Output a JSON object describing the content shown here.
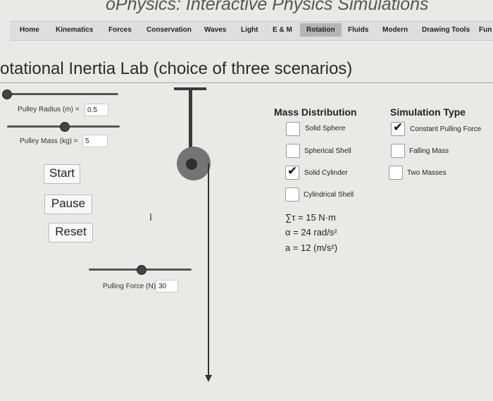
{
  "site": {
    "title": "oPhysics: Interactive Physics Simulations"
  },
  "nav": {
    "items": [
      {
        "label": "Home"
      },
      {
        "label": "Kinematics"
      },
      {
        "label": "Forces"
      },
      {
        "label": "Conservation"
      },
      {
        "label": "Waves"
      },
      {
        "label": "Light"
      },
      {
        "label": "E & M"
      },
      {
        "label": "Rotation",
        "active": true
      },
      {
        "label": "Fluids"
      },
      {
        "label": "Modern"
      },
      {
        "label": "Drawing Tools"
      },
      {
        "label": "Fun"
      }
    ]
  },
  "page": {
    "title": "otational Inertia Lab (choice of three scenarios)"
  },
  "controls": {
    "radius_label": "Pulley Radius (m) =",
    "radius_value": "0.5",
    "mass_label": "Pulley Mass (kg) =",
    "mass_value": "5",
    "force_label": "Pulling Force (N)",
    "force_value": "30"
  },
  "buttons": {
    "start": "Start",
    "pause": "Pause",
    "reset": "Reset"
  },
  "mass_distribution": {
    "heading": "Mass Distribution",
    "options": [
      {
        "label": "Solid Sphere",
        "checked": false
      },
      {
        "label": "Spherical Shell",
        "checked": false
      },
      {
        "label": "Solid Cylinder",
        "checked": true
      },
      {
        "label": "Cylindrical Shell",
        "checked": false
      }
    ]
  },
  "simulation_type": {
    "heading": "Simulation Type",
    "options": [
      {
        "label": "Constant Pulling Force",
        "checked": true
      },
      {
        "label": "Falling Mass",
        "checked": false
      },
      {
        "label": "Two Masses",
        "checked": false
      }
    ]
  },
  "results": {
    "torque": "∑τ = 15 N·m",
    "angular_accel": "α = 24 rad/s²",
    "accel": "a = 12 (m/s²)"
  },
  "icons": {
    "check": "check-icon",
    "cursor": "text-cursor-icon"
  }
}
